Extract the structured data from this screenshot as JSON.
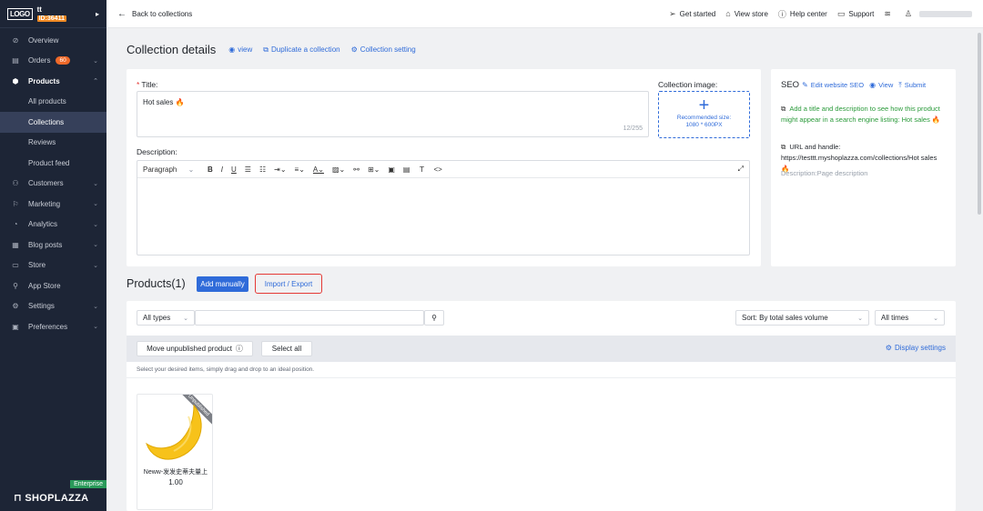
{
  "sidebar": {
    "logo": "LOGO",
    "store_name": "tt",
    "store_id": "ID:36411",
    "expand_glyph": "▸",
    "nav": [
      {
        "label": "Overview",
        "icon": "⊘"
      },
      {
        "label": "Orders",
        "icon": "▤",
        "badge": "60"
      },
      {
        "label": "Products",
        "icon": "⬢"
      },
      {
        "label": "All products"
      },
      {
        "label": "Collections"
      },
      {
        "label": "Reviews"
      },
      {
        "label": "Product feed"
      },
      {
        "label": "Customers",
        "icon": "⚇"
      },
      {
        "label": "Marketing",
        "icon": "⚐"
      },
      {
        "label": "Analytics",
        "icon": "◔"
      },
      {
        "label": "Blog posts",
        "icon": "▦"
      },
      {
        "label": "Store",
        "icon": "▭"
      },
      {
        "label": "App Store",
        "icon": "⚲"
      },
      {
        "label": "Settings",
        "icon": "⚙"
      },
      {
        "label": "Preferences",
        "icon": "▣"
      }
    ],
    "plan_badge": "Enterprise",
    "brand": "SHOPLAZZA"
  },
  "topbar": {
    "back_label": "Back to collections",
    "get_started": "Get started",
    "view_store": "View store",
    "help_center": "Help center",
    "support": "Support"
  },
  "page": {
    "title": "Collection details",
    "view_link": "view",
    "duplicate_link": "Duplicate a collection",
    "setting_link": "Collection setting"
  },
  "form": {
    "title_label": "Title:",
    "title_value": "Hot sales 🔥",
    "title_counter": "12/255",
    "image_label": "Collection image:",
    "image_hint_1": "Recommended size:",
    "image_hint_2": "1080 * 600PX",
    "description_label": "Description:",
    "paragraph": "Paragraph"
  },
  "seo": {
    "title": "SEO",
    "edit": "Edit website SEO",
    "view": "View",
    "submit": "Submit",
    "hint": "Add a title and description to see how this product might appear in a search engine listing: Hot sales 🔥",
    "url": "URL and handle: https://testtt.myshoplazza.com/collections/Hot sales 🔥",
    "description": "Description:Page description"
  },
  "products": {
    "title": "Products(1)",
    "add_manually": "Add manually",
    "import_export": "Import / Export",
    "type_filter": "All types",
    "sort": "Sort: By total sales volume",
    "time_filter": "All times",
    "move_unpublished": "Move unpublished product",
    "select_all": "Select all",
    "display_settings": "Display settings",
    "hint": "Select your desired items, simply drag and drop to an ideal position.",
    "items": [
      {
        "name": "Neww-发发史蒂夫量上",
        "price": "1.00",
        "status": "Unpublished"
      }
    ]
  }
}
